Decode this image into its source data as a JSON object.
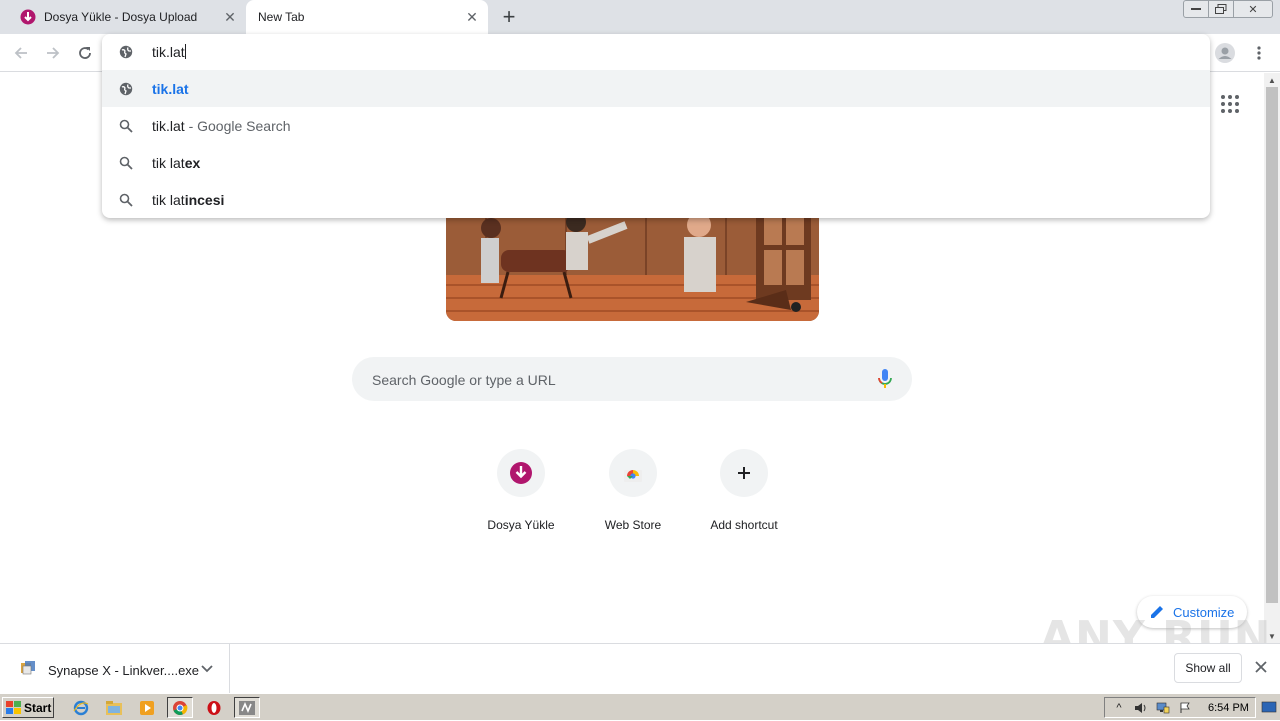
{
  "browser": {
    "tabs": [
      {
        "title": "Dosya Yükle - Dosya Upload",
        "active": false,
        "icon": "dosya-favicon"
      },
      {
        "title": "New Tab",
        "active": true
      }
    ]
  },
  "omnibox": {
    "input_value": "tik.lat",
    "suggestions": [
      {
        "type": "url",
        "icon": "globe-icon",
        "text": "tik.lat",
        "selected": true
      },
      {
        "type": "search",
        "icon": "search-icon",
        "prefix": "tik.lat",
        "bold": "",
        "suffix": " - Google Search"
      },
      {
        "type": "search",
        "icon": "search-icon",
        "prefix": "tik lat",
        "bold": "ex",
        "suffix": ""
      },
      {
        "type": "search",
        "icon": "search-icon",
        "prefix": "tik lat",
        "bold": "incesi",
        "suffix": ""
      }
    ]
  },
  "ntp": {
    "search_placeholder": "Search Google or type a URL",
    "shortcuts": [
      {
        "label": "Dosya Yükle",
        "icon": "dosya-icon"
      },
      {
        "label": "Web Store",
        "icon": "webstore-icon"
      },
      {
        "label": "Add shortcut",
        "icon": "plus-icon"
      }
    ],
    "customize_label": "Customize"
  },
  "watermark": "ANY RUN",
  "download_shelf": {
    "file_name": "Synapse X - Linkver....exe",
    "show_all_label": "Show all"
  },
  "taskbar": {
    "start_label": "Start",
    "clock": "6:54 PM"
  },
  "colors": {
    "accent": "#1a73e8",
    "tab_strip": "#dee1e6",
    "taskbar": "#d4d0c8"
  }
}
